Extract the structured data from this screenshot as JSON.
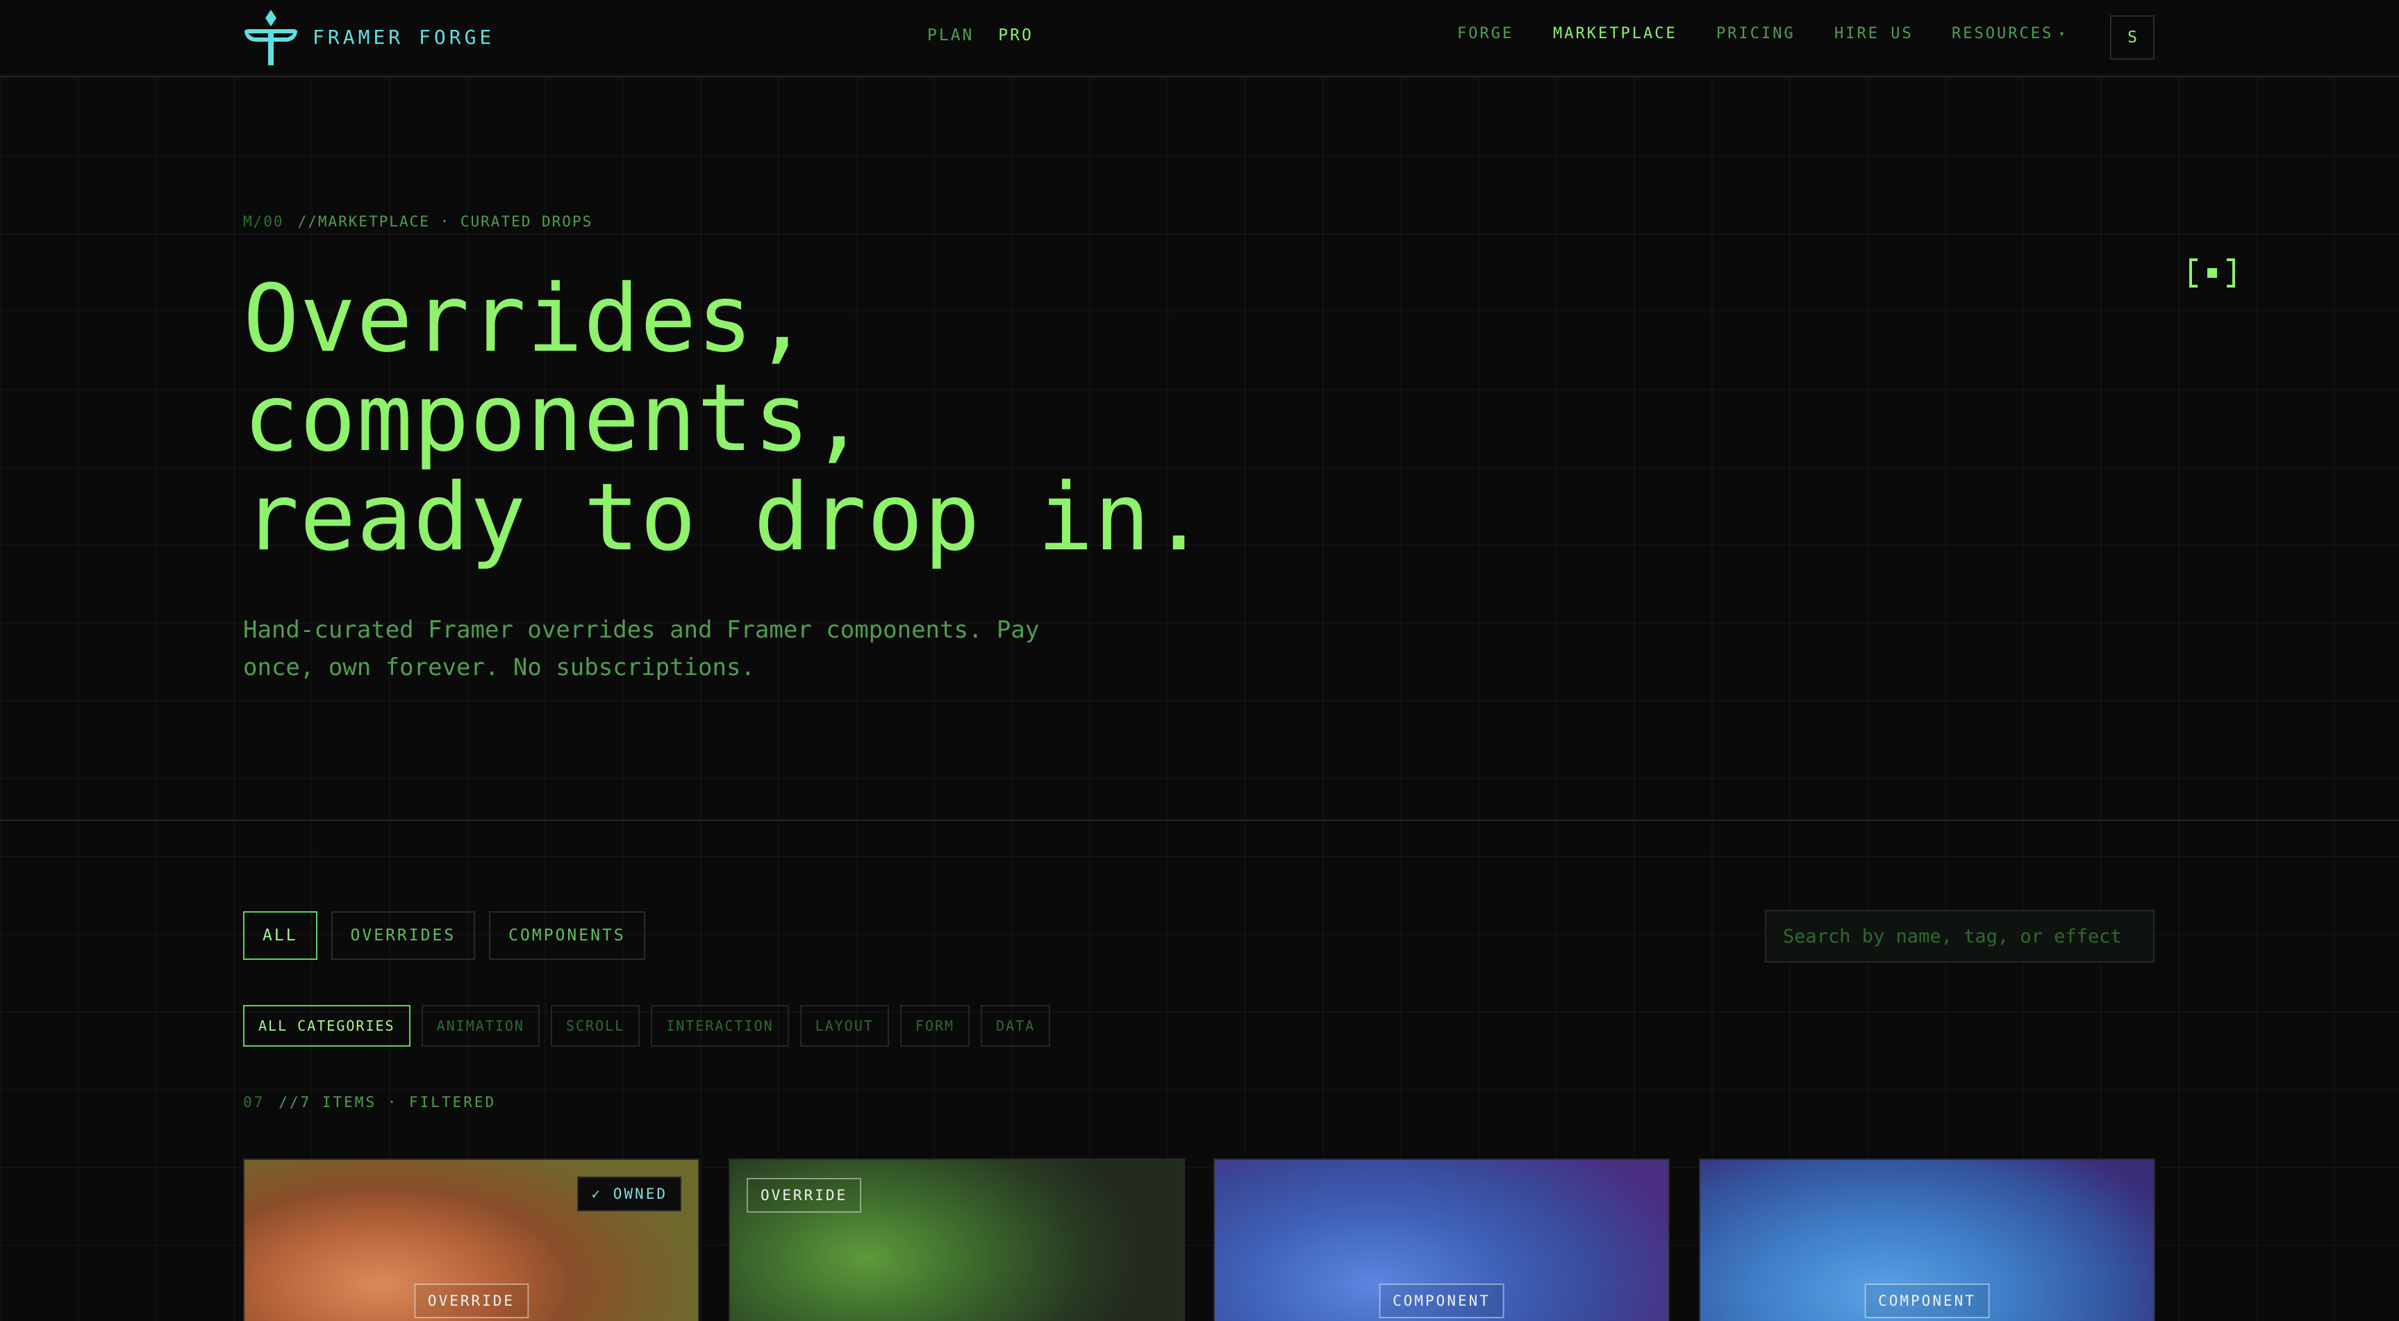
{
  "header": {
    "brand": "FRAMER FORGE",
    "plan_label": "PLAN",
    "plan_value": "PRO",
    "nav": [
      "FORGE",
      "MARKETPLACE",
      "PRICING",
      "HIRE US",
      "RESOURCES"
    ],
    "nav_active": "MARKETPLACE",
    "avatar_initial": "S"
  },
  "hero": {
    "eyebrow_code": "M/00",
    "eyebrow_text": "//MARKETPLACE · CURATED DROPS",
    "headline": [
      "Overrides,",
      "components,",
      "ready to drop in."
    ],
    "subcopy": "Hand-curated Framer overrides and Framer components. Pay once, own forever. No subscriptions."
  },
  "filters": {
    "types": [
      "ALL",
      "OVERRIDES",
      "COMPONENTS"
    ],
    "active_type": "ALL",
    "search_placeholder": "Search by name, tag, or effect",
    "search_value": "",
    "categories": [
      "ALL CATEGORIES",
      "ANIMATION",
      "SCROLL",
      "INTERACTION",
      "LAYOUT",
      "FORM",
      "DATA"
    ],
    "active_category": "ALL CATEGORIES",
    "count_num": "07",
    "count_text": "//7 ITEMS · FILTERED"
  },
  "cards": [
    {
      "type": "OVERRIDE",
      "badge": "✓ OWNED"
    },
    {
      "type": "OVERRIDE",
      "badge": ""
    },
    {
      "type": "COMPONENT",
      "badge": ""
    },
    {
      "type": "COMPONENT",
      "badge": ""
    }
  ],
  "colors": {
    "accent": "#8ef26b",
    "accent_dim": "#4f9f4f",
    "brand_cyan": "#5fe0e0",
    "background": "#0a0a0a"
  },
  "icons": {
    "logo": "forge-trident-icon",
    "hero_mark": "bracket-dot-icon",
    "resources_caret": "chevron-down-icon"
  }
}
